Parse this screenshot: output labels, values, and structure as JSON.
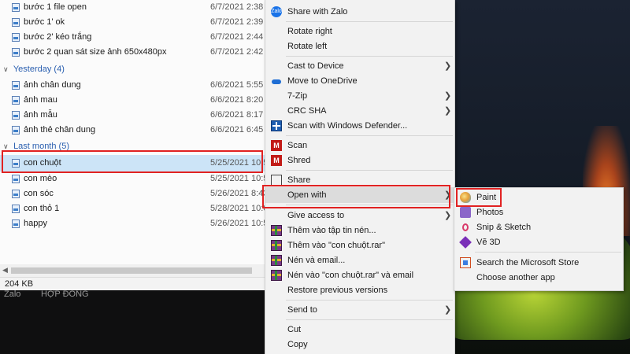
{
  "explorer": {
    "top_files": [
      {
        "name": "bước 1 file open",
        "date": "6/7/2021 2:38"
      },
      {
        "name": "bước 1' ok",
        "date": "6/7/2021 2:39"
      },
      {
        "name": "bước 2' kéo trắng",
        "date": "6/7/2021 2:44"
      },
      {
        "name": "bước 2 quan sát size ảnh 650x480px",
        "date": "6/7/2021 2:42"
      }
    ],
    "groups": [
      {
        "header": "Yesterday (4)",
        "files": [
          {
            "name": "ảnh chân dung",
            "date": "6/6/2021 5:55"
          },
          {
            "name": "ảnh mau",
            "date": "6/6/2021 8:20"
          },
          {
            "name": "ảnh mẫu",
            "date": "6/6/2021 8:17"
          },
          {
            "name": "ảnh thẻ chân dung",
            "date": "6/6/2021 6:45"
          }
        ]
      },
      {
        "header": "Last month (5)",
        "files": [
          {
            "name": "con chuột",
            "date": "5/25/2021 10:5"
          },
          {
            "name": "con mèo",
            "date": "5/25/2021 10:5"
          },
          {
            "name": "con sóc",
            "date": "5/26/2021 8:43"
          },
          {
            "name": "con thỏ 1",
            "date": "5/28/2021 10:0"
          },
          {
            "name": "happy",
            "date": "5/26/2021 10:5"
          }
        ]
      }
    ],
    "status": "204 KB"
  },
  "taskbar": {
    "left_label": "Zalo",
    "right_label": "HỢP ĐỒNG"
  },
  "context_menu": {
    "share_zalo": "Share with Zalo",
    "rotate_right": "Rotate right",
    "rotate_left": "Rotate left",
    "cast": "Cast to Device",
    "onedrive": "Move to OneDrive",
    "zip7": "7-Zip",
    "crc": "CRC SHA",
    "defender": "Scan with Windows Defender...",
    "scan": "Scan",
    "shred": "Shred",
    "share": "Share",
    "open_with": "Open with",
    "give_access": "Give access to",
    "rar_add": "Thêm vào tập tin nén...",
    "rar_add_named": "Thêm vào \"con chuột.rar\"",
    "rar_email": "Nén và email...",
    "rar_email_named": "Nén vào \"con chuột.rar\" và email",
    "restore": "Restore previous versions",
    "send_to": "Send to",
    "cut": "Cut",
    "copy": "Copy",
    "zalo_icon_text": "Zalo",
    "mcafee_letter": "M"
  },
  "submenu": {
    "paint": "Paint",
    "photos": "Photos",
    "snip": "Snip & Sketch",
    "ve3d": "Vẽ 3D",
    "store": "Search the Microsoft Store",
    "another": "Choose another app"
  },
  "colors": {
    "highlight_border": "#e12222",
    "selection": "#cce4f7",
    "group_header": "#2a5fb0"
  },
  "icons": [
    "file-image-icon",
    "zalo-icon",
    "onedrive-icon",
    "defender-icon",
    "mcafee-icon",
    "share-icon",
    "winrar-icon",
    "paint-icon",
    "photos-icon",
    "snip-sketch-icon",
    "paint-3d-icon",
    "store-icon",
    "chevron-right-icon",
    "chevron-down-icon"
  ]
}
